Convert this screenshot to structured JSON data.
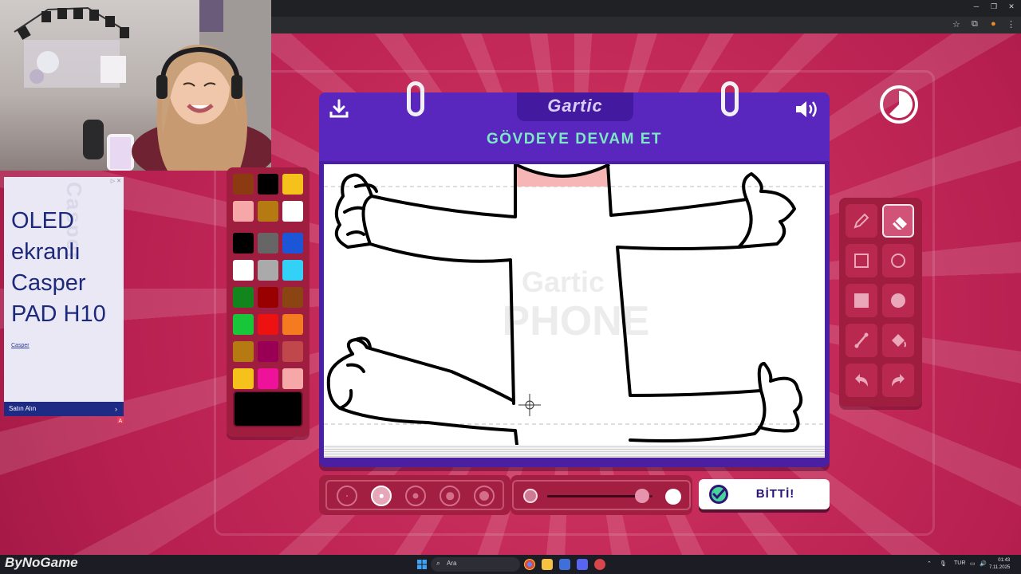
{
  "ad": {
    "headline": "OLED ekranlı Casper PAD H10",
    "brand": "Casper",
    "watermark": "Casper",
    "cta": "Satın Alın"
  },
  "game": {
    "logo": "Gartic",
    "instruction": "GÖVDEYE DEVAM ET",
    "done_label": "BİTTİ!",
    "canvas_watermark_top": "Gartic",
    "canvas_watermark_bottom": "PHONE"
  },
  "palette": {
    "colors": [
      "#8b3a12",
      "#000000",
      "#f4c21a",
      "#f6a8a8",
      "#b57b12",
      "#ffffff",
      "#000000",
      "#666666",
      "#1c55d6",
      "#ffffff",
      "#aaaaaa",
      "#34d1f6",
      "#12851d",
      "#990000",
      "#8b4513",
      "#18c63a",
      "#ee1111",
      "#f47b20",
      "#b57b12",
      "#990055",
      "#c0474c",
      "#f4c21a",
      "#ee1199",
      "#f6a8a8"
    ],
    "current_color": "#000000"
  },
  "tools": [
    "pencil",
    "eraser",
    "rectangle-outline",
    "circle-outline",
    "rectangle-filled",
    "circle-filled",
    "line",
    "bucket",
    "undo",
    "redo"
  ],
  "active_tool": "eraser",
  "brush_sizes": {
    "count": 5,
    "selected_index": 1
  },
  "opacity": {
    "value": 0.9
  },
  "taskbar": {
    "search_placeholder": "Ara",
    "language": "TUR",
    "time": "01:43",
    "date": "7.11.2025"
  },
  "stream_logo": "ByNoGame"
}
